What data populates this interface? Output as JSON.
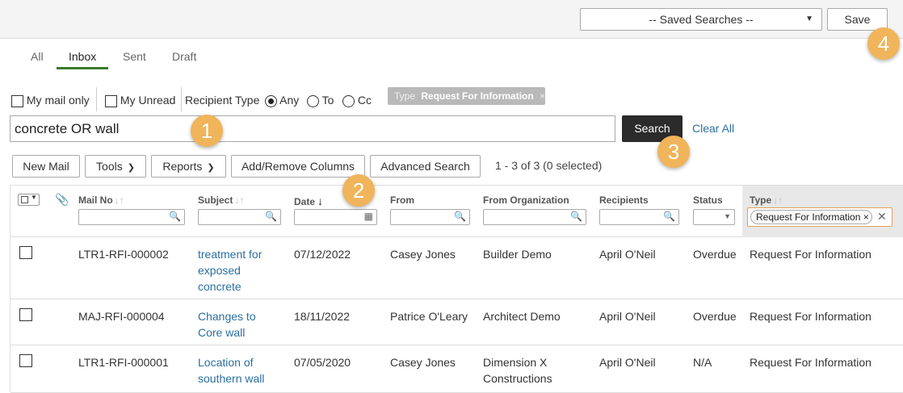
{
  "topbar": {
    "saved_searches": "-- Saved Searches --",
    "save_label": "Save"
  },
  "tabs": [
    {
      "label": "All"
    },
    {
      "label": "Inbox",
      "active": true
    },
    {
      "label": "Sent"
    },
    {
      "label": "Draft"
    }
  ],
  "filters": {
    "my_mail_only": "My mail only",
    "my_unread": "My Unread",
    "recipient_type_label": "Recipient Type",
    "options": [
      "Any",
      "To",
      "Cc"
    ],
    "selected": "Any"
  },
  "type_chip": {
    "key": "Type",
    "value": "Request For Information",
    "remove": "×"
  },
  "search": {
    "value": "concrete OR wall",
    "button_label": "Search",
    "clear_label": "Clear All"
  },
  "toolbar": {
    "new_mail": "New Mail",
    "tools": "Tools",
    "reports": "Reports",
    "add_remove_columns": "Add/Remove Columns",
    "advanced_search": "Advanced Search",
    "count": "1 - 3 of 3 (0 selected)"
  },
  "columns": {
    "mail_no": "Mail No",
    "subject": "Subject",
    "date": "Date",
    "from": "From",
    "from_org": "From Organization",
    "recipients": "Recipients",
    "status": "Status",
    "type": "Type",
    "type_filter_value": "Request For Information ×",
    "type_filter_clear": "✕"
  },
  "rows": [
    {
      "mail_no": "LTR1-RFI-000002",
      "subject": "treatment for exposed concrete",
      "date": "07/12/2022",
      "from": "Casey Jones",
      "from_org": "Builder Demo",
      "recipients": "April O'Neil",
      "status": "Overdue",
      "type": "Request For Information"
    },
    {
      "mail_no": "MAJ-RFI-000004",
      "subject": "Changes to Core wall",
      "date": "18/11/2022",
      "from": "Patrice O'Leary",
      "from_org": "Architect Demo",
      "recipients": "April O'Neil",
      "status": "Overdue",
      "type": "Request For Information"
    },
    {
      "mail_no": "LTR1-RFI-000001",
      "subject": "Location of southern wall",
      "date": "07/05/2020",
      "from": "Casey Jones",
      "from_org": "Dimension X Constructions",
      "recipients": "April O'Neil",
      "status": "N/A",
      "type": "Request For Information"
    }
  ],
  "callouts": [
    "1",
    "2",
    "3",
    "4"
  ],
  "colors": {
    "accent_tab": "#3a7a2a",
    "link": "#2a6fa0",
    "search_button": "#2b2b2b",
    "callout": "#f0b45a"
  }
}
